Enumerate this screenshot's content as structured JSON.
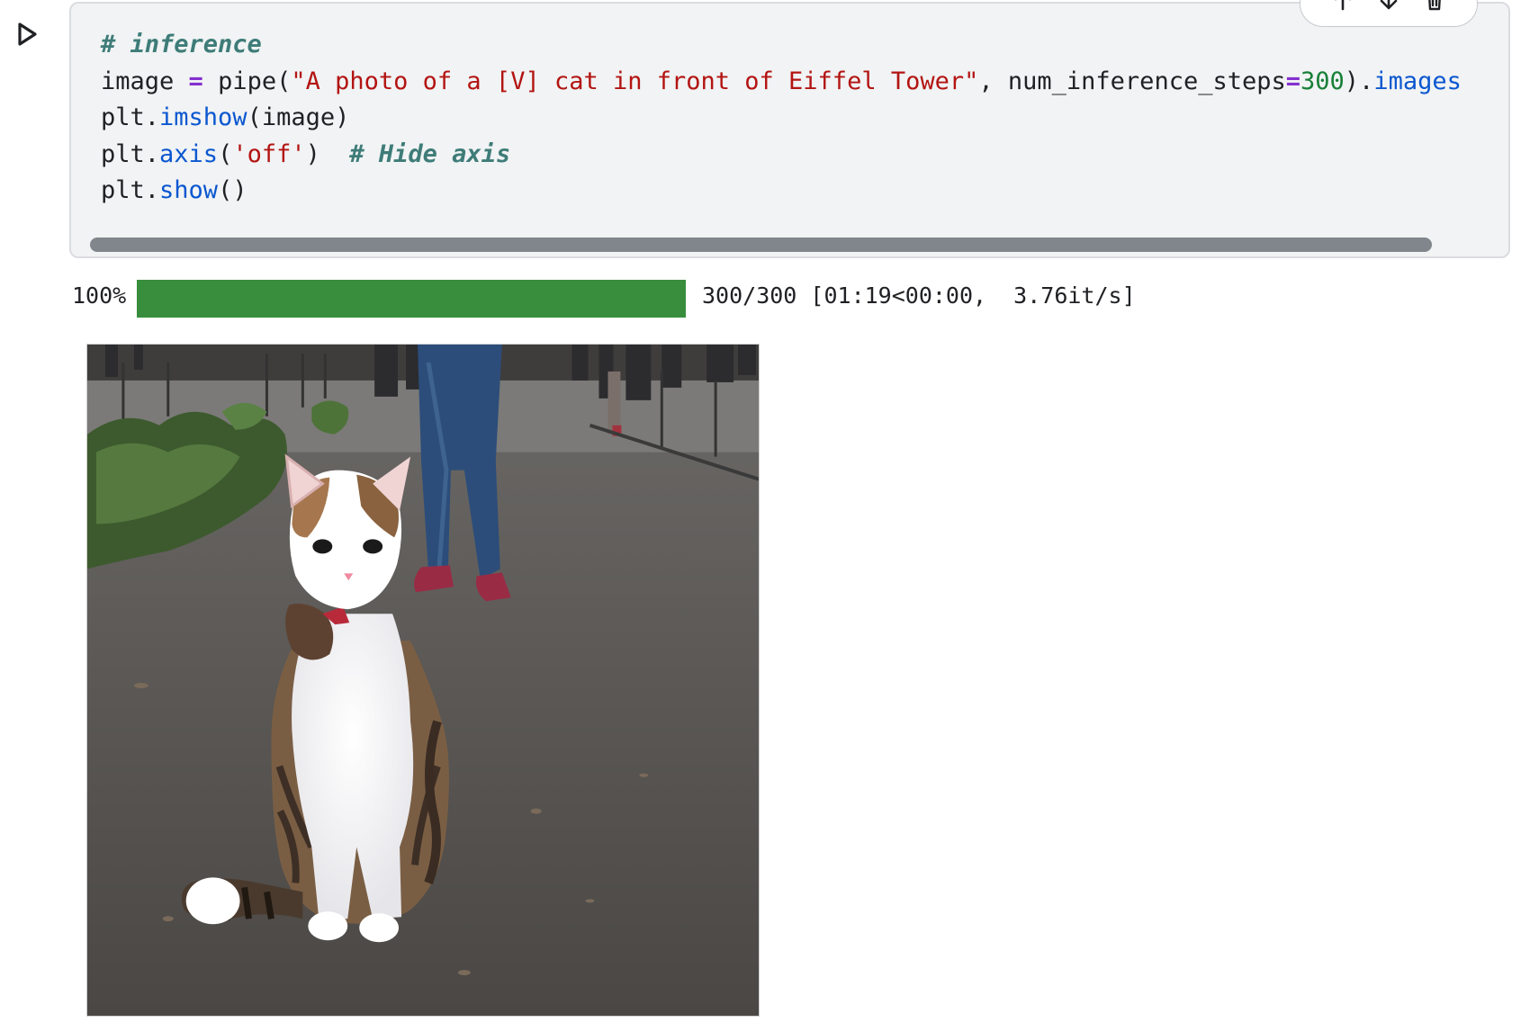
{
  "cell": {
    "run_icon": "play-icon",
    "toolbar_icons": [
      "move-up-icon",
      "move-down-icon",
      "delete-icon"
    ],
    "code": {
      "line1": {
        "comment": "# inference"
      },
      "line2": {
        "var": "image ",
        "eq": "=",
        "call": " pipe(",
        "prompt": "\"A photo of a [V] cat in front of Eiffel Tower\"",
        "sep": ", num_inference_steps",
        "eq2": "=",
        "steps": "300",
        "tail": ").",
        "attr": "images"
      },
      "line3": {
        "obj": "plt.",
        "fn": "imshow",
        "args": "(image)"
      },
      "line4": {
        "obj": "plt.",
        "fn": "axis",
        "open": "(",
        "arg": "'off'",
        "close": ")  ",
        "comment": "# Hide axis"
      },
      "line5": {
        "obj": "plt.",
        "fn": "show",
        "args": "()"
      }
    }
  },
  "output": {
    "progress": {
      "percent_text": "100%",
      "fraction": 1.0,
      "stats": "300/300 [01:19<00:00,  3.76it/s]",
      "color": "#388e3c"
    },
    "image_alt": "Generated photo of a calico cat sitting on a paved path with people in the background"
  }
}
